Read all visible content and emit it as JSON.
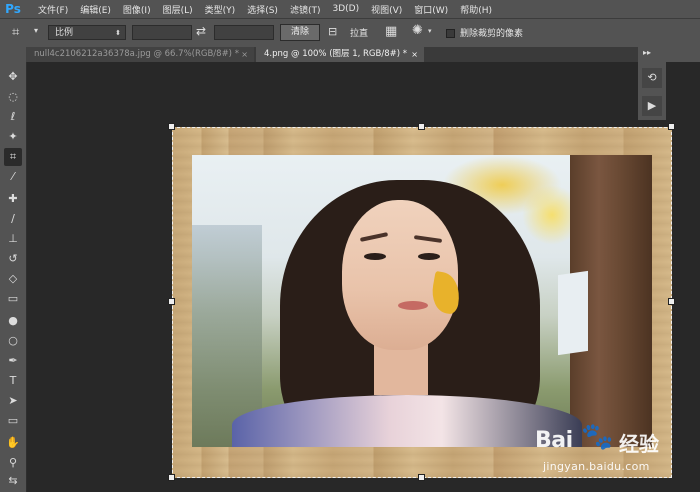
{
  "app": {
    "logo": "Ps"
  },
  "menu": [
    "文件(F)",
    "编辑(E)",
    "图像(I)",
    "图层(L)",
    "类型(Y)",
    "选择(S)",
    "滤镜(T)",
    "3D(D)",
    "视图(V)",
    "窗口(W)",
    "帮助(H)"
  ],
  "options": {
    "ratio_label": "比例",
    "clear_label": "清除",
    "straighten_label": "拉直",
    "delete_cropped_label": "删除裁剪的像素",
    "delete_cropped_checked": false
  },
  "tabs": [
    {
      "label": "null4c2106212a36378a.jpg @ 66.7%(RGB/8#) *",
      "active": false
    },
    {
      "label": "4.png @ 100% (图层 1, RGB/8#) *",
      "active": true
    }
  ],
  "tools": [
    "move-icon",
    "marquee-icon",
    "lasso-icon",
    "magic-wand-icon",
    "crop-icon",
    "eyedropper-icon",
    "healing-brush-icon",
    "brush-icon",
    "clone-stamp-icon",
    "history-brush-icon",
    "eraser-icon",
    "gradient-icon",
    "blur-icon",
    "dodge-icon",
    "pen-icon",
    "type-icon",
    "path-selection-icon",
    "rectangle-icon",
    "hand-icon",
    "zoom-icon",
    "swap-colors-icon"
  ],
  "watermark": {
    "brand": "Bai",
    "suffix": "经验",
    "url": "jingyan.baidu.com"
  },
  "colors": {
    "chrome": "#535353",
    "workspace": "#282828",
    "ps_blue": "#31a8ff"
  }
}
